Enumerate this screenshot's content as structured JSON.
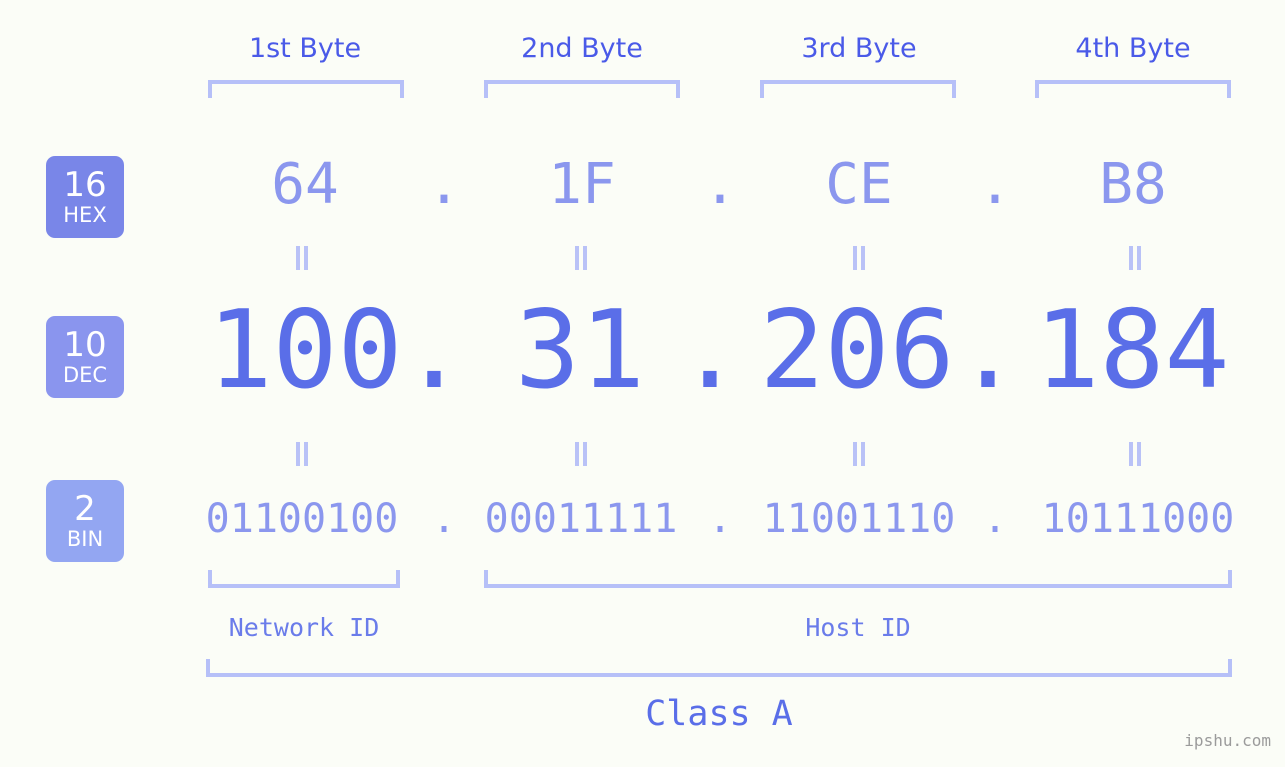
{
  "watermark": "ipshu.com",
  "colors": {
    "background": "#fbfdf7",
    "header_text": "#4a5ae8",
    "bracket": "#b6c0f8",
    "connector": "#b9c2f7",
    "hex_text": "#8b97ee",
    "dec_text": "#5a6ee8",
    "bin_text": "#8b97ee",
    "badge_hex": "#7986e8",
    "badge_dec": "#8a95ee",
    "badge_bin": "#93a6f2",
    "watermark_text": "#9b9b9b"
  },
  "byte_headers": [
    {
      "label": "1st Byte"
    },
    {
      "label": "2nd Byte"
    },
    {
      "label": "3rd Byte"
    },
    {
      "label": "4th Byte"
    }
  ],
  "badges": [
    {
      "base": "16",
      "name": "HEX"
    },
    {
      "base": "10",
      "name": "DEC"
    },
    {
      "base": "2",
      "name": "BIN"
    }
  ],
  "separator": ".",
  "connector": "=",
  "rows": {
    "hex": {
      "base_label": "16",
      "name": "HEX",
      "values": [
        "64",
        "1F",
        "CE",
        "B8"
      ]
    },
    "dec": {
      "base_label": "10",
      "name": "DEC",
      "values": [
        "100",
        "31",
        "206",
        "184"
      ]
    },
    "bin": {
      "base_label": "2",
      "name": "BIN",
      "values": [
        "01100100",
        "00011111",
        "11001110",
        "10111000"
      ]
    }
  },
  "sections": {
    "network_id": "Network ID",
    "host_id": "Host ID",
    "class": "Class A"
  }
}
